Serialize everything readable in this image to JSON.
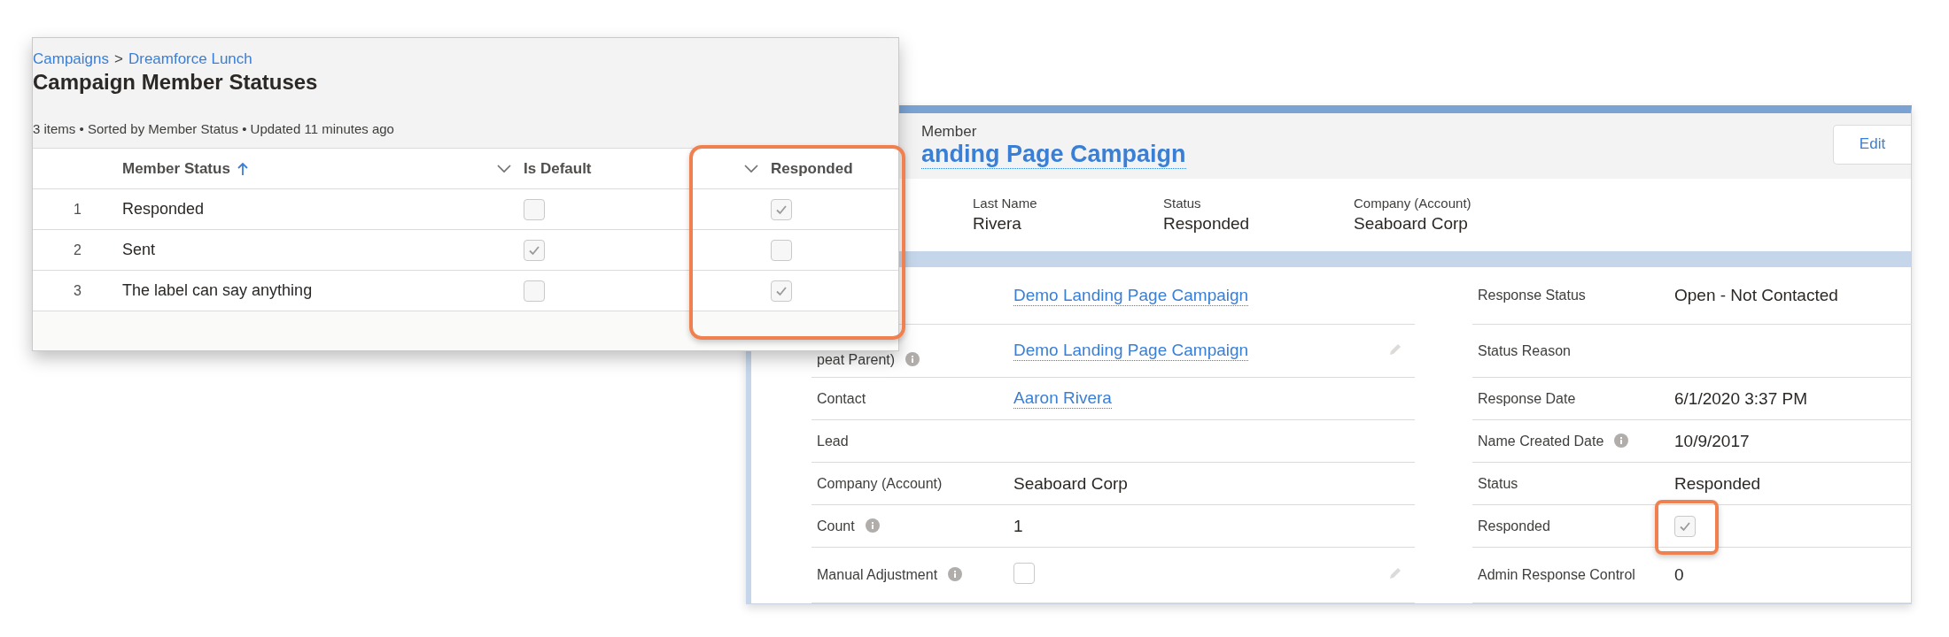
{
  "list_panel": {
    "breadcrumbs": [
      {
        "label": "Campaigns"
      },
      {
        "label": "Dreamforce Lunch"
      }
    ],
    "breadcrumb_separator": ">",
    "title": "Campaign Member Statuses",
    "summary": "3 items • Sorted by Member Status • Updated 11 minutes ago",
    "columns": [
      {
        "label": "Member Status",
        "sorted": true,
        "highlighted": false
      },
      {
        "label": "Is Default",
        "sorted": false,
        "highlighted": false
      },
      {
        "label": "Responded",
        "sorted": false,
        "highlighted": true
      }
    ],
    "rows": [
      {
        "number": "1",
        "member_status": "Responded",
        "is_default": false,
        "responded": true
      },
      {
        "number": "2",
        "member_status": "Sent",
        "is_default": true,
        "responded": false
      },
      {
        "number": "3",
        "member_status": "The label can say anything",
        "is_default": false,
        "responded": true
      }
    ]
  },
  "record_panel": {
    "object_label": "Member",
    "title": "anding Page Campaign",
    "edit_button": "Edit",
    "highlights": [
      {
        "label": "Last Name",
        "value": "Rivera"
      },
      {
        "label": "Status",
        "value": "Responded"
      },
      {
        "label": "Company (Account)",
        "value": "Seaboard Corp"
      }
    ],
    "rows": [
      {
        "left": {
          "kind": "link",
          "value": "Demo Landing Page Campaign",
          "info": false,
          "edit_icon": false
        },
        "right": {
          "kind": "text",
          "label": "Response Status",
          "value": "Open - Not Contacted",
          "info": false,
          "highlighted": false
        }
      },
      {
        "left": {
          "kind": "link",
          "label": "peat Parent)",
          "value": "Demo Landing Page Campaign",
          "info": true,
          "edit_icon": true
        },
        "right": {
          "kind": "text",
          "label": "Status Reason",
          "info": false,
          "highlighted": false
        }
      },
      {
        "left": {
          "kind": "link",
          "label": "Contact",
          "value": "Aaron Rivera",
          "info": false,
          "edit_icon": false
        },
        "right": {
          "kind": "text",
          "label": "Response Date",
          "value": "6/1/2020 3:37 PM",
          "info": false,
          "highlighted": false
        }
      },
      {
        "left": {
          "kind": "text",
          "label": "Lead",
          "info": false,
          "edit_icon": false
        },
        "right": {
          "kind": "text",
          "label": "Name Created Date",
          "value": "10/9/2017",
          "info": true,
          "highlighted": false
        }
      },
      {
        "left": {
          "kind": "text",
          "label": "Company (Account)",
          "value": "Seaboard Corp",
          "info": false,
          "edit_icon": false
        },
        "right": {
          "kind": "text",
          "label": "Status",
          "value": "Responded",
          "info": false,
          "highlighted": false
        }
      },
      {
        "left": {
          "kind": "text",
          "label": "Count",
          "value": "1",
          "info": true,
          "edit_icon": false
        },
        "right": {
          "kind": "checkbox",
          "label": "Responded",
          "checked": true,
          "info": false,
          "highlighted": true
        }
      },
      {
        "left": {
          "kind": "checkbox",
          "label": "Manual Adjustment",
          "checked": false,
          "info": true,
          "edit_icon": true
        },
        "right": {
          "kind": "text",
          "label": "Admin Response Control",
          "value": "0",
          "info": false,
          "highlighted": false
        }
      }
    ]
  }
}
